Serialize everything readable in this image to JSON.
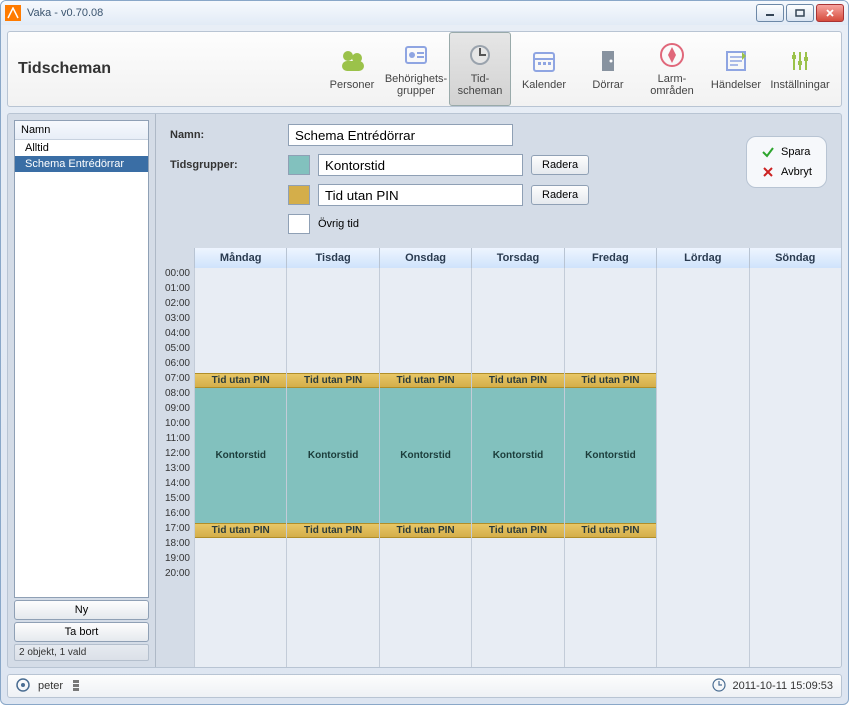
{
  "window_title": "Vaka - v0.70.08",
  "header_title": "Tidscheman",
  "toolbar": [
    {
      "id": "personer",
      "label": "Personer"
    },
    {
      "id": "behorighets",
      "label": "Behörighets-\ngrupper"
    },
    {
      "id": "tidscheman",
      "label": "Tid-\nscheman",
      "selected": true
    },
    {
      "id": "kalender",
      "label": "Kalender"
    },
    {
      "id": "dorrar",
      "label": "Dörrar"
    },
    {
      "id": "larm",
      "label": "Larm-\nområden"
    },
    {
      "id": "handelser",
      "label": "Händelser"
    },
    {
      "id": "installningar",
      "label": "Inställningar"
    }
  ],
  "sidebar": {
    "header": "Namn",
    "items": [
      {
        "label": "Alltid",
        "selected": false
      },
      {
        "label": "Schema Entrédörrar",
        "selected": true
      }
    ],
    "new_btn": "Ny",
    "delete_btn": "Ta bort",
    "status": "2 objekt, 1 vald"
  },
  "form": {
    "name_label": "Namn:",
    "name_value": "Schema Entrédörrar",
    "groups_label": "Tidsgrupper:",
    "groups": [
      {
        "color": "#82c1be",
        "name": "Kontorstid",
        "delete": "Radera"
      },
      {
        "color": "#d4ae4a",
        "name": "Tid utan PIN",
        "delete": "Radera"
      },
      {
        "color": "#ffffff",
        "name": "Övrig tid",
        "delete": null
      }
    ],
    "save": "Spara",
    "cancel": "Avbryt"
  },
  "calendar": {
    "days": [
      "Måndag",
      "Tisdag",
      "Onsdag",
      "Torsdag",
      "Fredag",
      "Lördag",
      "Söndag"
    ],
    "hours": [
      "00:00",
      "01:00",
      "02:00",
      "03:00",
      "04:00",
      "05:00",
      "06:00",
      "07:00",
      "08:00",
      "09:00",
      "10:00",
      "11:00",
      "12:00",
      "13:00",
      "14:00",
      "15:00",
      "16:00",
      "17:00",
      "18:00",
      "19:00",
      "20:00"
    ],
    "blocks_weekday": [
      {
        "type": "pin",
        "label": "Tid utan PIN",
        "start": 7,
        "end": 8
      },
      {
        "type": "office",
        "label": "Kontorstid",
        "start": 8,
        "end": 17
      },
      {
        "type": "pin",
        "label": "Tid utan PIN",
        "start": 17,
        "end": 18
      }
    ]
  },
  "status": {
    "user": "peter",
    "datetime": "2011-10-11 15:09:53"
  }
}
